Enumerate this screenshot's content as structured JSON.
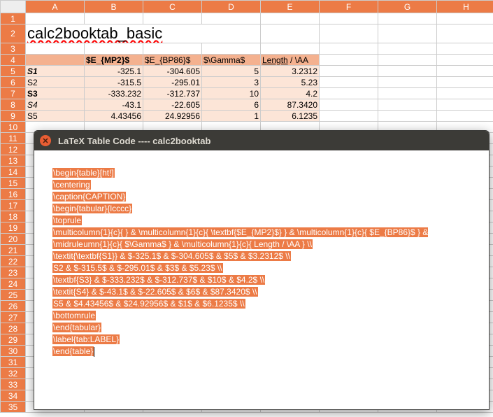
{
  "columns": [
    "A",
    "B",
    "C",
    "D",
    "E",
    "F",
    "G",
    "H"
  ],
  "title": "calc2booktab_basic",
  "headers": [
    "",
    "$E_{MP2}$",
    "$E_{BP86}$",
    "$\\Gamma$",
    "Length / \\AA"
  ],
  "rows": [
    {
      "label": "S1",
      "vals": [
        "-325.1",
        "-304.605",
        "5",
        "3.2312"
      ],
      "bold": true,
      "italic": true
    },
    {
      "label": "S2",
      "vals": [
        "-315.5",
        "-295.01",
        "3",
        "5.23"
      ],
      "bold": false,
      "italic": false
    },
    {
      "label": "S3",
      "vals": [
        "-333.232",
        "-312.737",
        "10",
        "4.2"
      ],
      "bold": true,
      "italic": false
    },
    {
      "label": "S4",
      "vals": [
        "-43.1",
        "-22.605",
        "6",
        "87.3420"
      ],
      "bold": false,
      "italic": true
    },
    {
      "label": "S5",
      "vals": [
        "4.43456",
        "24.92956",
        "1",
        "6.1235"
      ],
      "bold": false,
      "italic": false
    }
  ],
  "dialog": {
    "title": "LaTeX Table Code ---- calc2booktab",
    "lines": [
      "\\begin{table}[ht!]",
      "\\centering",
      "\\caption{CAPTION}",
      "\\begin{tabular}{lcccc}",
      "\\toprule",
      "\\multicolumn{1}{c}{ } & \\multicolumn{1}{c}{ \\textbf{$E_{MP2}$} } & \\multicolumn{1}{c}{ $E_{BP86}$ } & \\multicolumn{1}{c}{ $\\Gamma$ } & \\multicolumn{1}{c}{ Length / \\AA } \\\\",
      "\\midrule",
      "\\textit{\\textbf{S1}} & $-325.1$ & $-304.605$ & $5$ & $3.2312$ \\\\",
      "S2 & $-315.5$ & $-295.01$ & $3$ & $5.23$ \\\\",
      "\\textbf{S3} & $-333.232$ & $-312.737$ & $10$ & $4.2$ \\\\",
      "\\textit{S4} & $-43.1$ & $-22.605$ & $6$ & $87.3420$ \\\\",
      "S5 & $4.43456$ & $24.92956$ & $1$ & $6.1235$ \\\\",
      "\\bottomrule",
      "\\end{tabular}",
      "\\label{tab:LABEL}",
      "\\end{table}"
    ]
  }
}
